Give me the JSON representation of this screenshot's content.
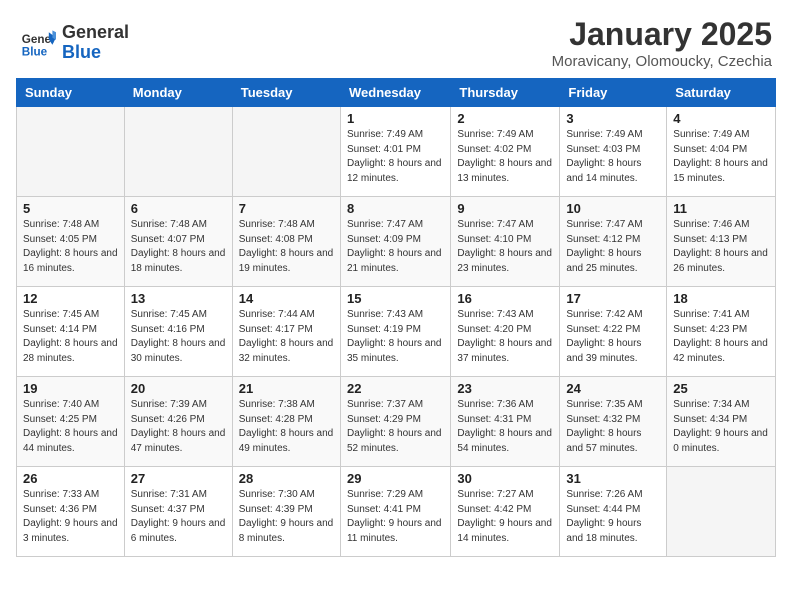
{
  "header": {
    "logo_line1": "General",
    "logo_line2": "Blue",
    "month": "January 2025",
    "location": "Moravicany, Olomoucky, Czechia"
  },
  "weekdays": [
    "Sunday",
    "Monday",
    "Tuesday",
    "Wednesday",
    "Thursday",
    "Friday",
    "Saturday"
  ],
  "weeks": [
    [
      {
        "day": "",
        "empty": true
      },
      {
        "day": "",
        "empty": true
      },
      {
        "day": "",
        "empty": true
      },
      {
        "day": "1",
        "sunrise": "7:49 AM",
        "sunset": "4:01 PM",
        "daylight": "8 hours and 12 minutes."
      },
      {
        "day": "2",
        "sunrise": "7:49 AM",
        "sunset": "4:02 PM",
        "daylight": "8 hours and 13 minutes."
      },
      {
        "day": "3",
        "sunrise": "7:49 AM",
        "sunset": "4:03 PM",
        "daylight": "8 hours and 14 minutes."
      },
      {
        "day": "4",
        "sunrise": "7:49 AM",
        "sunset": "4:04 PM",
        "daylight": "8 hours and 15 minutes."
      }
    ],
    [
      {
        "day": "5",
        "sunrise": "7:48 AM",
        "sunset": "4:05 PM",
        "daylight": "8 hours and 16 minutes."
      },
      {
        "day": "6",
        "sunrise": "7:48 AM",
        "sunset": "4:07 PM",
        "daylight": "8 hours and 18 minutes."
      },
      {
        "day": "7",
        "sunrise": "7:48 AM",
        "sunset": "4:08 PM",
        "daylight": "8 hours and 19 minutes."
      },
      {
        "day": "8",
        "sunrise": "7:47 AM",
        "sunset": "4:09 PM",
        "daylight": "8 hours and 21 minutes."
      },
      {
        "day": "9",
        "sunrise": "7:47 AM",
        "sunset": "4:10 PM",
        "daylight": "8 hours and 23 minutes."
      },
      {
        "day": "10",
        "sunrise": "7:47 AM",
        "sunset": "4:12 PM",
        "daylight": "8 hours and 25 minutes."
      },
      {
        "day": "11",
        "sunrise": "7:46 AM",
        "sunset": "4:13 PM",
        "daylight": "8 hours and 26 minutes."
      }
    ],
    [
      {
        "day": "12",
        "sunrise": "7:45 AM",
        "sunset": "4:14 PM",
        "daylight": "8 hours and 28 minutes."
      },
      {
        "day": "13",
        "sunrise": "7:45 AM",
        "sunset": "4:16 PM",
        "daylight": "8 hours and 30 minutes."
      },
      {
        "day": "14",
        "sunrise": "7:44 AM",
        "sunset": "4:17 PM",
        "daylight": "8 hours and 32 minutes."
      },
      {
        "day": "15",
        "sunrise": "7:43 AM",
        "sunset": "4:19 PM",
        "daylight": "8 hours and 35 minutes."
      },
      {
        "day": "16",
        "sunrise": "7:43 AM",
        "sunset": "4:20 PM",
        "daylight": "8 hours and 37 minutes."
      },
      {
        "day": "17",
        "sunrise": "7:42 AM",
        "sunset": "4:22 PM",
        "daylight": "8 hours and 39 minutes."
      },
      {
        "day": "18",
        "sunrise": "7:41 AM",
        "sunset": "4:23 PM",
        "daylight": "8 hours and 42 minutes."
      }
    ],
    [
      {
        "day": "19",
        "sunrise": "7:40 AM",
        "sunset": "4:25 PM",
        "daylight": "8 hours and 44 minutes."
      },
      {
        "day": "20",
        "sunrise": "7:39 AM",
        "sunset": "4:26 PM",
        "daylight": "8 hours and 47 minutes."
      },
      {
        "day": "21",
        "sunrise": "7:38 AM",
        "sunset": "4:28 PM",
        "daylight": "8 hours and 49 minutes."
      },
      {
        "day": "22",
        "sunrise": "7:37 AM",
        "sunset": "4:29 PM",
        "daylight": "8 hours and 52 minutes."
      },
      {
        "day": "23",
        "sunrise": "7:36 AM",
        "sunset": "4:31 PM",
        "daylight": "8 hours and 54 minutes."
      },
      {
        "day": "24",
        "sunrise": "7:35 AM",
        "sunset": "4:32 PM",
        "daylight": "8 hours and 57 minutes."
      },
      {
        "day": "25",
        "sunrise": "7:34 AM",
        "sunset": "4:34 PM",
        "daylight": "9 hours and 0 minutes."
      }
    ],
    [
      {
        "day": "26",
        "sunrise": "7:33 AM",
        "sunset": "4:36 PM",
        "daylight": "9 hours and 3 minutes."
      },
      {
        "day": "27",
        "sunrise": "7:31 AM",
        "sunset": "4:37 PM",
        "daylight": "9 hours and 6 minutes."
      },
      {
        "day": "28",
        "sunrise": "7:30 AM",
        "sunset": "4:39 PM",
        "daylight": "9 hours and 8 minutes."
      },
      {
        "day": "29",
        "sunrise": "7:29 AM",
        "sunset": "4:41 PM",
        "daylight": "9 hours and 11 minutes."
      },
      {
        "day": "30",
        "sunrise": "7:27 AM",
        "sunset": "4:42 PM",
        "daylight": "9 hours and 14 minutes."
      },
      {
        "day": "31",
        "sunrise": "7:26 AM",
        "sunset": "4:44 PM",
        "daylight": "9 hours and 18 minutes."
      },
      {
        "day": "",
        "empty": true
      }
    ]
  ]
}
